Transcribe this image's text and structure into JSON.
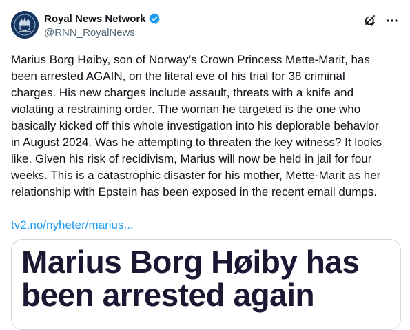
{
  "author": {
    "display_name": "Royal News Network",
    "handle": "@RNN_RoyalNews",
    "verified": true,
    "avatar_icon": "crest-icon"
  },
  "tweet": {
    "text": "Marius Borg Høiby, son of Norway’s Crown Princess Mette-Marit, has\nbeen arrested AGAIN, on the literal eve of his trial for 38 criminal\ncharges. His new charges include assault, threats with a knife and\nviolating a restraining order. The woman he targeted is the one who\nbasically kicked off this whole investigation into his deplorable behavior\nin August 2024. Was he attempting to threaten the key witness? It looks\nlike. Given his risk of recidivism, Marius will now be held in jail for four\nweeks. This is a catastrophic disaster for his mother, Mette-Marit as her\nrelationship with Epstein has been exposed in the recent email dumps.",
    "link_text": "tv2.no/nyheter/marius..."
  },
  "card": {
    "headline": "Marius Borg Høiby has\nbeen arrested again"
  },
  "colors": {
    "verified_badge": "#1d9bf0",
    "link": "#1d9bf0",
    "text": "#0f1419",
    "secondary_text": "#536471",
    "headline": "#1c1733"
  },
  "icons": {
    "grok": "grok-icon",
    "more": "more-icon"
  }
}
